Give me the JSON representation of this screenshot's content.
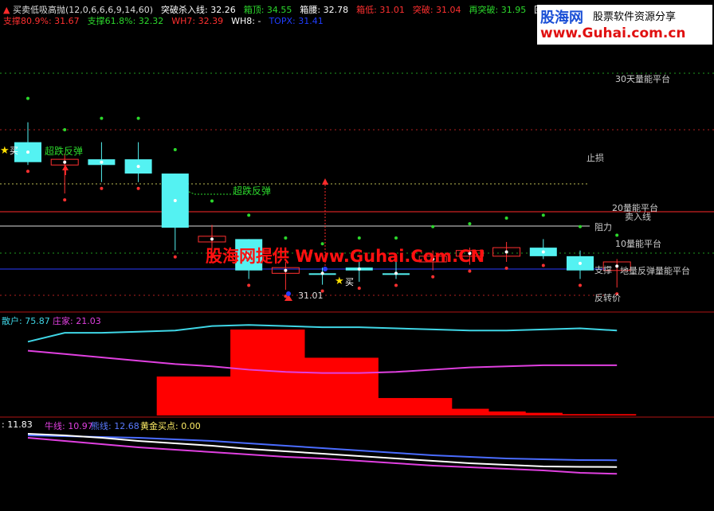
{
  "header": {
    "row1": [
      {
        "label": "买卖低吸高抛(12,0,6,6,6,9,14,60)",
        "color": "#dddddd"
      },
      {
        "label": "突破杀入线: 32.26",
        "color": "#ffffff"
      },
      {
        "label": "箱顶: 34.55",
        "color": "#2cd82c"
      },
      {
        "label": "箱腰: 32.78",
        "color": "#ffffff"
      },
      {
        "label": "箱低: 31.01",
        "color": "#ff3030"
      },
      {
        "label": "突破: 31.04",
        "color": "#ff3030"
      },
      {
        "label": "再突破: 31.95",
        "color": "#2cd82c"
      },
      {
        "label": "回踩",
        "color": "#ffffff"
      }
    ],
    "row2": [
      {
        "label": "支撑80.9%: 31.67",
        "color": "#ff3030"
      },
      {
        "label": "支撑61.8%: 32.32",
        "color": "#2cd82c"
      },
      {
        "label": "WH7: 32.39",
        "color": "#ff3030"
      },
      {
        "label": "WH8: -",
        "color": "#ffffff"
      },
      {
        "label": "TOPX: 31.41",
        "color": "#1f3dff"
      }
    ]
  },
  "logo": {
    "main": "股海网",
    "tagline": "股票软件资源分享",
    "url": "www.Guhai.com.cn"
  },
  "watermark": "股海网提供 Www.Guhai.Com.CN",
  "levels": [
    {
      "label": "30天量能平台",
      "color": "#ffffff"
    },
    {
      "label": "止损",
      "color": "#ffee66"
    },
    {
      "label": "20量能平台",
      "color": "#ffffff"
    },
    {
      "label": "卖入线",
      "color": "#2cd82c"
    },
    {
      "label": "阻力",
      "color": "#ffffff"
    },
    {
      "label": "10量能平台",
      "color": "#ffffff"
    },
    {
      "label": "支撑",
      "color": "#ffffff"
    },
    {
      "label": "地量反弹量能平台",
      "color": "#ffffff"
    },
    {
      "label": "反转价",
      "color": "#e040e0"
    }
  ],
  "annotations": {
    "buy_top": "买",
    "rebound1": "超跌反弹",
    "rebound2": "超跌反弹",
    "low_price": "31.01",
    "buy_mid": "买"
  },
  "panel2": {
    "retail_label": "散户: 75.87",
    "dealer_label": "庄家: 21.03",
    "retail_color": "#3fd6e6",
    "dealer_color": "#e040e0"
  },
  "panel3": {
    "l1_label": ": 11.83",
    "l2_label": "牛线: 10.97",
    "l3_label": "熊线: 12.68",
    "l4_label": "黄金买点: 0.00"
  },
  "chart_data": {
    "type": "candlestick",
    "candles": [
      {
        "open": 33.6,
        "high": 33.95,
        "low": 33.2,
        "close": 33.25,
        "color": "cyan"
      },
      {
        "open": 33.2,
        "high": 33.4,
        "low": 32.7,
        "close": 33.3,
        "color": "red"
      },
      {
        "open": 33.3,
        "high": 33.6,
        "low": 32.9,
        "close": 33.2,
        "color": "cyan"
      },
      {
        "open": 33.3,
        "high": 33.6,
        "low": 32.9,
        "close": 33.05,
        "color": "cyan"
      },
      {
        "open": 33.05,
        "high": 33.05,
        "low": 31.7,
        "close": 32.1,
        "color": "cyan"
      },
      {
        "open": 31.95,
        "high": 32.15,
        "low": 31.7,
        "close": 31.85,
        "color": "red"
      },
      {
        "open": 31.9,
        "high": 31.9,
        "low": 31.2,
        "close": 31.35,
        "color": "cyan"
      },
      {
        "open": 31.4,
        "high": 31.5,
        "low": 31.01,
        "close": 31.3,
        "color": "red"
      },
      {
        "open": 31.3,
        "high": 31.4,
        "low": 31.1,
        "close": 31.3,
        "color": "cyan"
      },
      {
        "open": 31.4,
        "high": 31.5,
        "low": 31.15,
        "close": 31.35,
        "color": "cyan"
      },
      {
        "open": 31.3,
        "high": 31.5,
        "low": 31.2,
        "close": 31.3,
        "color": "cyan"
      },
      {
        "open": 31.5,
        "high": 31.7,
        "low": 31.35,
        "close": 31.6,
        "color": "red"
      },
      {
        "open": 31.6,
        "high": 31.75,
        "low": 31.45,
        "close": 31.7,
        "color": "red"
      },
      {
        "open": 31.75,
        "high": 31.85,
        "low": 31.5,
        "close": 31.6,
        "color": "red"
      },
      {
        "open": 31.75,
        "high": 31.9,
        "low": 31.55,
        "close": 31.6,
        "color": "cyan"
      },
      {
        "open": 31.6,
        "high": 31.7,
        "low": 31.2,
        "close": 31.35,
        "color": "cyan"
      },
      {
        "open": 31.35,
        "high": 31.55,
        "low": 31.05,
        "close": 31.5,
        "color": "red"
      }
    ],
    "level_values": {
      "box_top": 34.55,
      "box_mid": 32.78,
      "breakout_entry": 32.26,
      "support_61_8": 32.32,
      "box_low": 31.01
    },
    "panel2_series": [
      {
        "name": "散户",
        "values": [
          66,
          74,
          74,
          75,
          76,
          80,
          81,
          80,
          79,
          79,
          78,
          77,
          76,
          76,
          77,
          78,
          76
        ]
      },
      {
        "name": "庄家",
        "values": [
          58,
          55,
          52,
          49,
          46,
          44,
          41,
          39,
          38,
          38,
          39,
          41,
          43,
          44,
          45,
          45,
          45
        ]
      }
    ],
    "panel2_bars": [
      0,
      0,
      0,
      0,
      29,
      29,
      64,
      64,
      43,
      43,
      13,
      13,
      5,
      3,
      2,
      1,
      1
    ],
    "panel3_series": [
      {
        "name": "牛线",
        "values": [
          15.5,
          15.1,
          14.7,
          14.3,
          14.0,
          13.7,
          13.4,
          13.1,
          12.9,
          12.6,
          12.3,
          12.0,
          11.8,
          11.6,
          11.4,
          11.1,
          10.97
        ]
      },
      {
        "name": "熊线",
        "values": [
          15.8,
          15.7,
          15.6,
          15.5,
          15.3,
          15.1,
          14.8,
          14.5,
          14.2,
          13.9,
          13.6,
          13.3,
          13.1,
          12.9,
          12.8,
          12.7,
          12.68
        ]
      },
      {
        "name": "l1",
        "values": [
          16.0,
          15.8,
          15.5,
          15.1,
          14.8,
          14.5,
          14.1,
          13.8,
          13.5,
          13.2,
          12.9,
          12.6,
          12.3,
          12.1,
          11.9,
          11.85,
          11.83
        ]
      }
    ]
  }
}
